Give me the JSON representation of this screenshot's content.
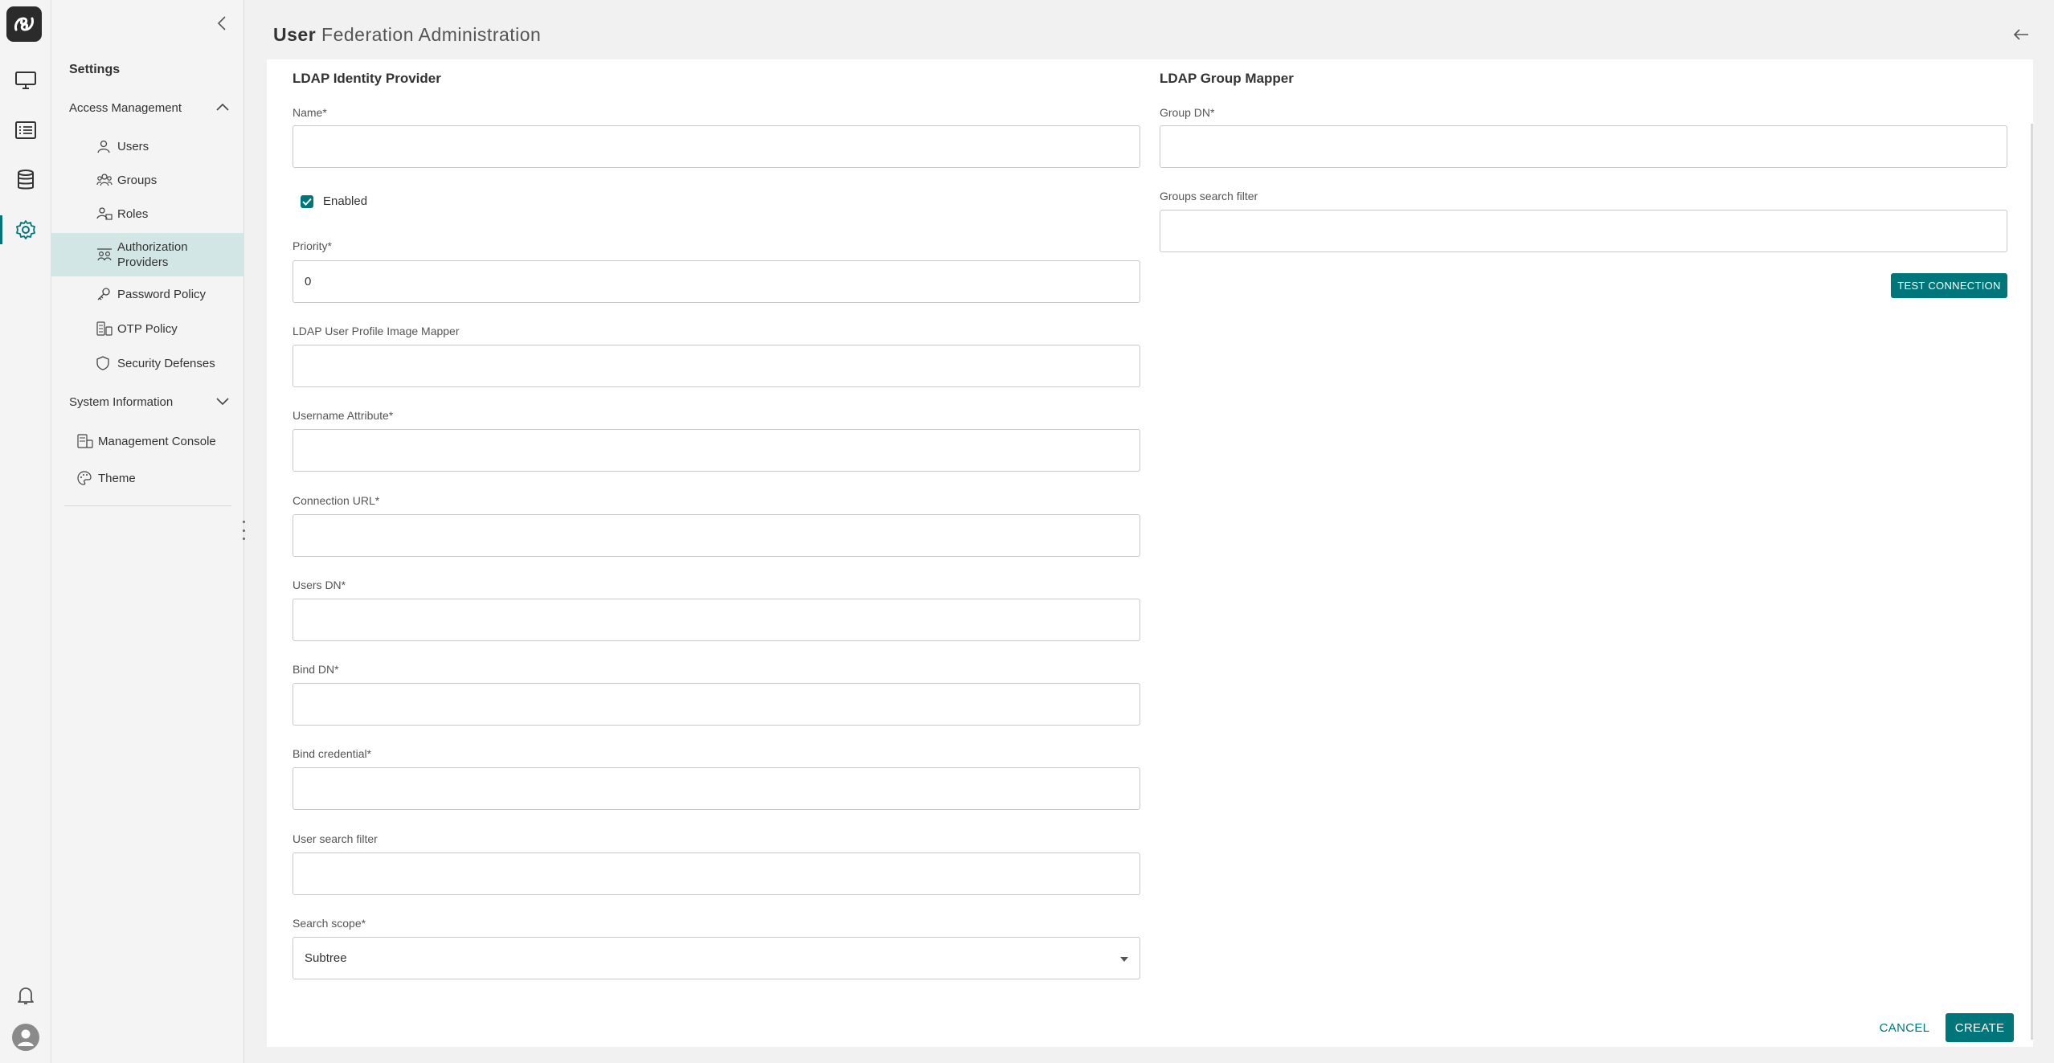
{
  "header": {
    "title_bold": "User",
    "title_rest": "Federation Administration"
  },
  "sidebar": {
    "title": "Settings",
    "sections": [
      {
        "label": "Access Management",
        "expanded": true
      },
      {
        "label": "System Information",
        "expanded": false
      }
    ],
    "access_items": [
      {
        "label": "Users",
        "icon": "user-icon"
      },
      {
        "label": "Groups",
        "icon": "groups-icon"
      },
      {
        "label": "Roles",
        "icon": "roles-icon"
      },
      {
        "label_line1": "Authorization",
        "label_line2": "Providers",
        "icon": "authorization-providers-icon",
        "selected": true
      },
      {
        "label": "Password Policy",
        "icon": "key-icon"
      },
      {
        "label": "OTP Policy",
        "icon": "otp-icon"
      },
      {
        "label": "Security Defenses",
        "icon": "shield-icon"
      }
    ],
    "system_items": [
      {
        "label": "Management Console",
        "icon": "console-icon"
      },
      {
        "label": "Theme",
        "icon": "palette-icon"
      }
    ]
  },
  "ldap": {
    "title": "LDAP Identity Provider",
    "name_label": "Name*",
    "name_value": "",
    "enabled_label": "Enabled",
    "enabled": true,
    "priority_label": "Priority*",
    "priority_value": "0",
    "image_mapper_label": "LDAP User Profile Image Mapper",
    "image_mapper_value": "",
    "username_attr_label": "Username Attribute*",
    "username_attr_value": "",
    "connection_url_label": "Connection URL*",
    "connection_url_value": "",
    "users_dn_label": "Users DN*",
    "users_dn_value": "",
    "bind_dn_label": "Bind DN*",
    "bind_dn_value": "",
    "bind_credential_label": "Bind credential*",
    "bind_credential_value": "",
    "user_search_filter_label": "User search filter",
    "user_search_filter_value": "",
    "search_scope_label": "Search scope*",
    "search_scope_value": "Subtree"
  },
  "group_mapper": {
    "title": "LDAP Group Mapper",
    "group_dn_label": "Group DN*",
    "group_dn_value": "",
    "groups_filter_label": "Groups search filter",
    "groups_filter_value": "",
    "test_connection_label": "TEST CONNECTION"
  },
  "actions": {
    "cancel_label": "CANCEL",
    "create_label": "CREATE"
  },
  "colors": {
    "accent": "#00767a",
    "selected_bg": "#d3e6e6"
  }
}
